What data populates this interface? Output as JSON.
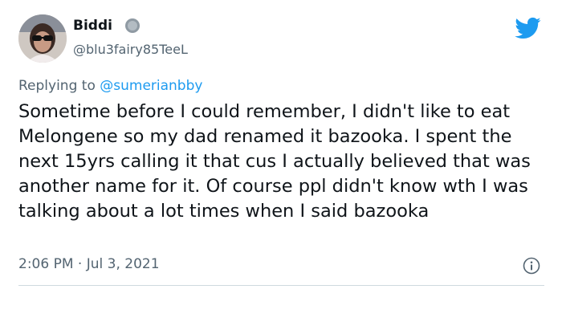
{
  "tweet": {
    "author": {
      "name": "Biddi",
      "handle": "@blu3fairy85TeeL",
      "badge_icon": "gray-circle-badge-icon",
      "avatar_icon": "profile-avatar"
    },
    "platform_icon": "twitter-bird-icon",
    "reply_prefix": "Replying to",
    "reply_to": "@sumerianbby",
    "text": "Sometime before I could remember, I didn't like to eat Melongene so my dad renamed it bazooka. I spent the next 15yrs calling it that cus I actually believed that was another name for it. Of course ppl didn't know wth I was talking about a lot times when I said bazooka",
    "time": "2:06 PM",
    "separator": "·",
    "date": "Jul 3, 2021",
    "info_icon": "info-icon"
  },
  "colors": {
    "brand": "#1d9bf0",
    "text": "#0f1419",
    "secondary": "#536471",
    "divider": "#cfd9de"
  }
}
